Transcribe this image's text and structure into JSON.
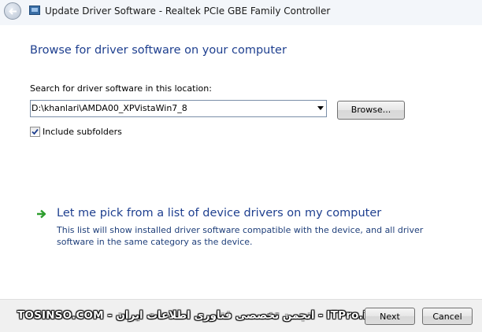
{
  "window": {
    "title": "Update Driver Software - Realtek PCIe GBE Family Controller"
  },
  "main": {
    "heading": "Browse for driver software on your computer",
    "search_label": "Search for driver software in this location:",
    "path_value": "D:\\khanlari\\AMDA00_XPVistaWin7_8",
    "browse_label": "Browse...",
    "include_subfolders_label": "Include subfolders",
    "include_subfolders_checked": true,
    "pick_link": "Let me pick from a list of device drivers on my computer",
    "pick_description": "This list will show installed driver software compatible with the device, and all driver software in the same category as the device."
  },
  "footer": {
    "watermark": "TOSINSO.COM - انجمن تخصصی فناوری اطلاعات ایران - ITPro.ir",
    "next_label": "Next",
    "cancel_label": "Cancel"
  },
  "colors": {
    "heading": "#1e3f8f",
    "link_arrow": "#2e9e2e"
  },
  "icons": {
    "back": "back-arrow-icon",
    "title": "device-manager-icon",
    "pick": "green-arrow-icon",
    "dropdown": "chevron-down-icon",
    "checkbox": "checkmark-icon"
  }
}
